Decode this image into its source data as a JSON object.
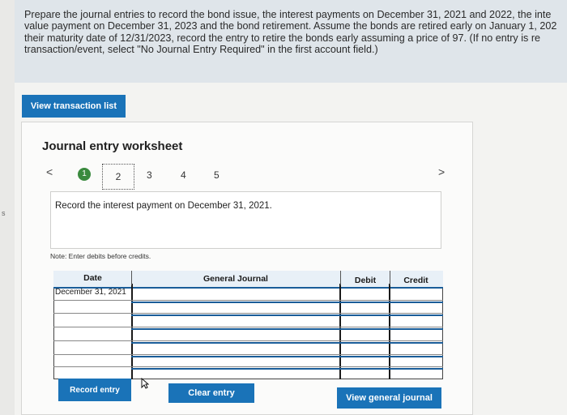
{
  "instructions": {
    "lines": [
      "Prepare the journal entries to record the bond issue, the interest payments on December 31, 2021 and 2022, the inte",
      "value payment on December 31, 2023 and the bond retirement. Assume the bonds are retired early on January 1, 202",
      "their maturity date of 12/31/2023, record the entry to retire the bonds early assuming a price of 97. (If no entry is re",
      "transaction/event, select \"No Journal Entry Required\" in the first account field.)"
    ]
  },
  "buttons": {
    "view_transaction_list": "View transaction list",
    "record_entry": "Record entry",
    "clear_entry": "Clear entry",
    "view_general_journal": "View general journal"
  },
  "worksheet": {
    "title": "Journal entry worksheet",
    "nav_prev": "<",
    "nav_next": ">",
    "steps": [
      "1",
      "2",
      "3",
      "4",
      "5"
    ],
    "current_step": 1,
    "instruction": "Record the interest payment on December 31, 2021.",
    "note": "Note: Enter debits before credits."
  },
  "table": {
    "headers": {
      "date": "Date",
      "general_journal": "General Journal",
      "debit": "Debit",
      "credit": "Credit"
    },
    "rows": [
      {
        "date": "December 31, 2021",
        "account": "",
        "debit": "",
        "credit": ""
      },
      {
        "date": "",
        "account": "",
        "debit": "",
        "credit": ""
      },
      {
        "date": "",
        "account": "",
        "debit": "",
        "credit": ""
      },
      {
        "date": "",
        "account": "",
        "debit": "",
        "credit": ""
      },
      {
        "date": "",
        "account": "",
        "debit": "",
        "credit": ""
      },
      {
        "date": "",
        "account": "",
        "debit": "",
        "credit": ""
      }
    ]
  },
  "colors": {
    "accent": "#1a73b8",
    "step_active": "#3a8a3e",
    "instructions_bg": "#dfe5ea"
  },
  "left_edge_mark": "s"
}
